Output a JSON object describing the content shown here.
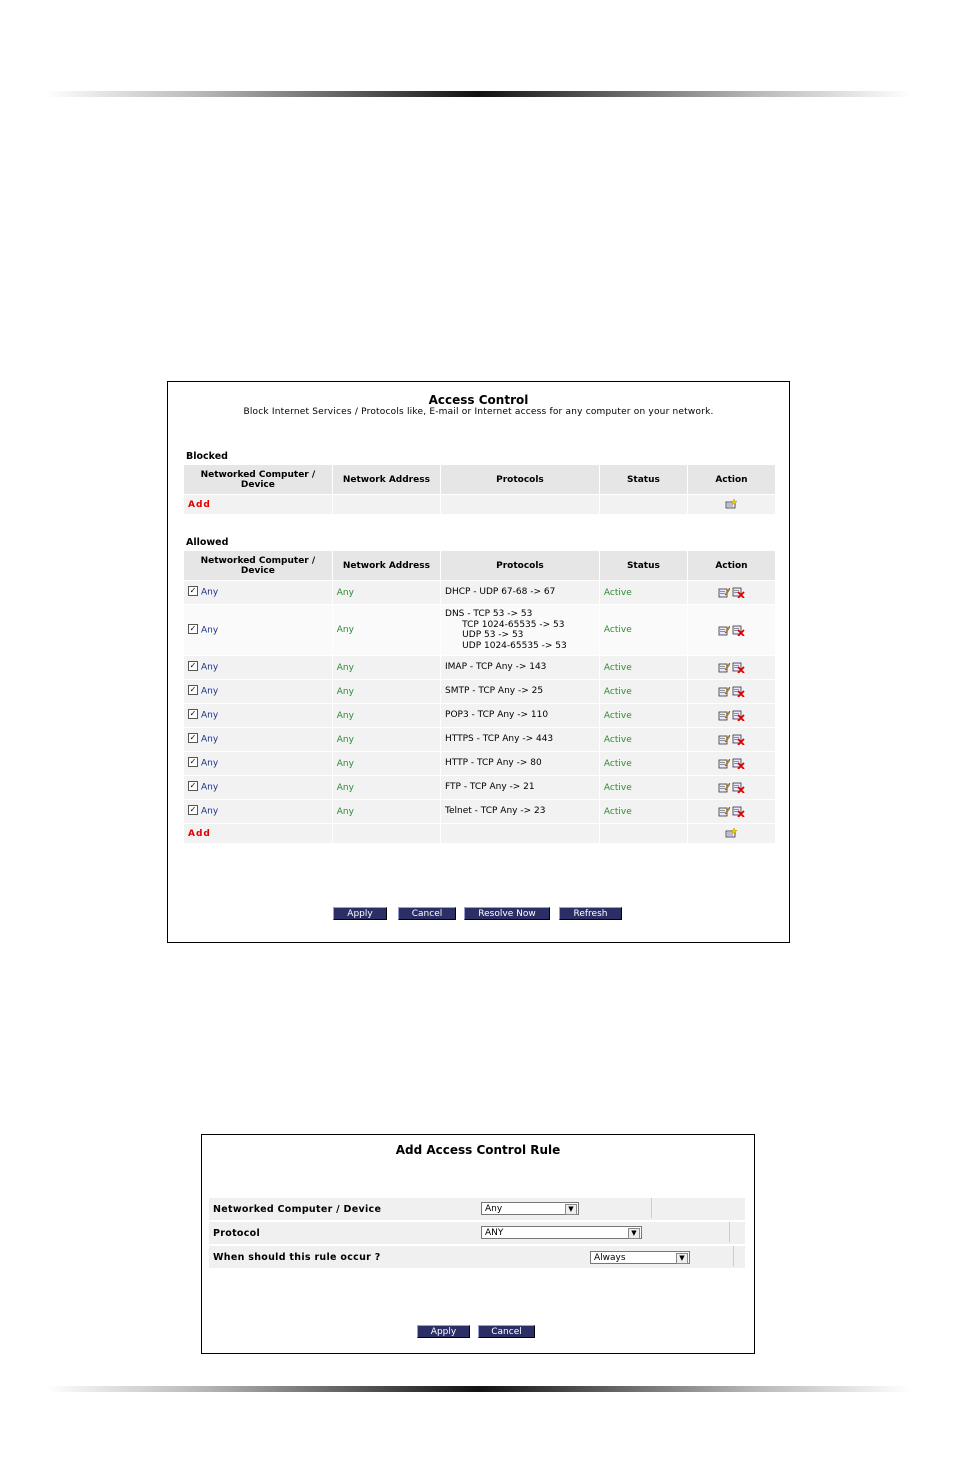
{
  "access_control": {
    "title": "Access Control",
    "subtitle": "Block Internet Services / Protocols like, E-mail or Internet access for any computer on your network.",
    "columns": [
      "Networked Computer / Device",
      "Network Address",
      "Protocols",
      "Status",
      "Action"
    ],
    "blocked": {
      "label": "Blocked",
      "add_label": "Add"
    },
    "allowed": {
      "label": "Allowed",
      "add_label": "Add",
      "rows": [
        {
          "device": "Any",
          "address": "Any",
          "protocol": [
            "DHCP - UDP 67-68 -> 67"
          ],
          "status": "Active"
        },
        {
          "device": "Any",
          "address": "Any",
          "protocol": [
            "DNS - TCP 53 -> 53",
            "      TCP 1024-65535 -> 53",
            "      UDP 53 -> 53",
            "      UDP 1024-65535 -> 53"
          ],
          "status": "Active"
        },
        {
          "device": "Any",
          "address": "Any",
          "protocol": [
            "IMAP - TCP Any -> 143"
          ],
          "status": "Active"
        },
        {
          "device": "Any",
          "address": "Any",
          "protocol": [
            "SMTP - TCP Any -> 25"
          ],
          "status": "Active"
        },
        {
          "device": "Any",
          "address": "Any",
          "protocol": [
            "POP3 - TCP Any -> 110"
          ],
          "status": "Active"
        },
        {
          "device": "Any",
          "address": "Any",
          "protocol": [
            "HTTPS - TCP Any -> 443"
          ],
          "status": "Active"
        },
        {
          "device": "Any",
          "address": "Any",
          "protocol": [
            "HTTP - TCP Any -> 80"
          ],
          "status": "Active"
        },
        {
          "device": "Any",
          "address": "Any",
          "protocol": [
            "FTP - TCP Any -> 21"
          ],
          "status": "Active"
        },
        {
          "device": "Any",
          "address": "Any",
          "protocol": [
            "Telnet - TCP Any -> 23"
          ],
          "status": "Active"
        }
      ]
    },
    "buttons": {
      "apply": "Apply",
      "cancel": "Cancel",
      "resolve": "Resolve Now",
      "refresh": "Refresh"
    }
  },
  "add_rule": {
    "title": "Add Access Control Rule",
    "fields": {
      "device_label": "Networked Computer / Device",
      "device_value": "Any",
      "protocol_label": "Protocol",
      "protocol_value": "ANY",
      "when_label": "When should this rule occur ?",
      "when_value": "Always"
    },
    "buttons": {
      "apply": "Apply",
      "cancel": "Cancel"
    }
  },
  "colors": {
    "button_bg": "#2b2f66",
    "status_green": "#2e8b2e",
    "add_red": "#e00000",
    "device_blue": "#1a2f8a"
  },
  "icons": {
    "edit": "edit-icon",
    "delete": "delete-icon",
    "add": "add-icon",
    "checkbox": "checkbox-icon"
  }
}
